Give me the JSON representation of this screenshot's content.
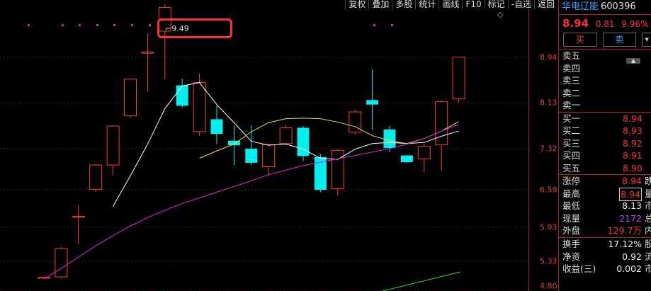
{
  "toolbar": [
    "复权",
    "叠加",
    "多股",
    "统计",
    "画线",
    "F10",
    "标记",
    "-自选",
    "返回"
  ],
  "stock": {
    "name": "华电辽能",
    "code": "600396",
    "price": "8.94",
    "change": "0.81",
    "change_pct": "9.96%"
  },
  "trade": {
    "buy": "买",
    "sell": "卖"
  },
  "sell_orders": [
    {
      "label": "卖五"
    },
    {
      "label": "卖四"
    },
    {
      "label": "卖三"
    },
    {
      "label": "卖二"
    },
    {
      "label": "卖一"
    }
  ],
  "buy_orders": [
    {
      "label": "买一",
      "value": "8.94"
    },
    {
      "label": "买二",
      "value": "8.93"
    },
    {
      "label": "买三",
      "value": "8.92"
    },
    {
      "label": "买四",
      "value": "8.91"
    },
    {
      "label": "买五",
      "value": "8.90"
    }
  ],
  "stats": [
    {
      "label": "涨停",
      "value": "8.94",
      "label2": "跌"
    },
    {
      "label": "最高",
      "value": "8.94",
      "label2": "量"
    },
    {
      "label": "最低",
      "value": "8.13",
      "label2": "市"
    },
    {
      "label": "现量",
      "value": "2172",
      "label2": "总"
    },
    {
      "label": "外盘",
      "value": "129.7万",
      "label2": "内"
    }
  ],
  "stats2": [
    {
      "label": "换手",
      "value": "17.12%",
      "label2": "股"
    },
    {
      "label": "净资",
      "value": "0.92",
      "label2": "流"
    },
    {
      "label": "收益(三)",
      "value": "0.002",
      "label2": "市"
    }
  ],
  "chart": {
    "high_marker": "9.49",
    "price_ticks": [
      "8.94",
      "8.13",
      "7.32",
      "6.59",
      "5.93",
      "5.33",
      "4.80"
    ]
  },
  "chart_data": {
    "type": "candlestick",
    "candles": [
      {
        "open": 5.04,
        "close": 5.04,
        "high": 5.04,
        "low": 5.04
      },
      {
        "open": 5.05,
        "close": 5.55,
        "high": 5.58,
        "low": 5.02
      },
      {
        "open": 6.12,
        "close": 6.12,
        "high": 6.32,
        "low": 5.62
      },
      {
        "open": 6.6,
        "close": 7.03,
        "high": 7.05,
        "low": 6.55
      },
      {
        "open": 7.03,
        "close": 7.72,
        "high": 7.73,
        "low": 6.85
      },
      {
        "open": 7.9,
        "close": 8.55,
        "high": 8.56,
        "low": 7.86
      },
      {
        "open": 9.01,
        "close": 9.03,
        "high": 9.36,
        "low": 8.33
      },
      {
        "open": 9.4,
        "close": 9.82,
        "high": 9.88,
        "low": 8.55
      },
      {
        "open": 8.44,
        "close": 8.08,
        "high": 8.56,
        "low": 8.05
      },
      {
        "open": 7.62,
        "close": 8.49,
        "high": 8.65,
        "low": 7.55
      },
      {
        "open": 7.84,
        "close": 7.58,
        "high": 8.08,
        "low": 7.4
      },
      {
        "open": 7.46,
        "close": 7.38,
        "high": 7.73,
        "low": 7.03
      },
      {
        "open": 7.32,
        "close": 7.07,
        "high": 7.73,
        "low": 7.03
      },
      {
        "open": 7.0,
        "close": 7.39,
        "high": 7.41,
        "low": 6.85
      },
      {
        "open": 7.41,
        "close": 7.69,
        "high": 7.74,
        "low": 7.39
      },
      {
        "open": 7.69,
        "close": 7.19,
        "high": 7.72,
        "low": 7.1
      },
      {
        "open": 7.17,
        "close": 6.59,
        "high": 7.23,
        "low": 6.55
      },
      {
        "open": 6.61,
        "close": 7.29,
        "high": 7.31,
        "low": 6.49
      },
      {
        "open": 7.61,
        "close": 7.97,
        "high": 8.01,
        "low": 7.56
      },
      {
        "open": 8.18,
        "close": 8.1,
        "high": 8.72,
        "low": 7.65
      },
      {
        "open": 7.66,
        "close": 7.33,
        "high": 7.72,
        "low": 7.26
      },
      {
        "open": 7.2,
        "close": 7.08,
        "high": 7.2,
        "low": 7.07
      },
      {
        "open": 7.14,
        "close": 7.36,
        "high": 7.41,
        "low": 6.9
      },
      {
        "open": 7.39,
        "close": 8.15,
        "high": 8.17,
        "low": 6.93
      },
      {
        "open": 8.2,
        "close": 8.94,
        "high": 8.94,
        "low": 8.13
      }
    ],
    "ma5": [
      null,
      null,
      null,
      null,
      6.3,
      6.84,
      7.4,
      8.03,
      8.43,
      8.49,
      8.1,
      7.78,
      7.45,
      7.38,
      7.4,
      7.31,
      7.15,
      7.13,
      7.31,
      7.41,
      7.43,
      7.41,
      7.43,
      7.54,
      7.63
    ],
    "ma10": [
      null,
      null,
      null,
      null,
      null,
      null,
      null,
      null,
      null,
      7.15,
      7.28,
      7.4,
      7.62,
      7.78,
      7.85,
      7.86,
      7.85,
      7.79,
      7.71,
      7.55,
      7.46,
      7.41,
      7.5,
      7.63,
      7.8
    ],
    "ma30": [
      5.01,
      5.2,
      5.4,
      5.6,
      5.78,
      5.95,
      6.1,
      6.23,
      6.35,
      6.45,
      6.55,
      6.65,
      6.75,
      6.86,
      6.94,
      7.02,
      7.08,
      7.14,
      7.2,
      7.26,
      7.32,
      7.4,
      7.5,
      7.63,
      7.75
    ],
    "ylim": [
      4.8,
      9.5
    ]
  }
}
